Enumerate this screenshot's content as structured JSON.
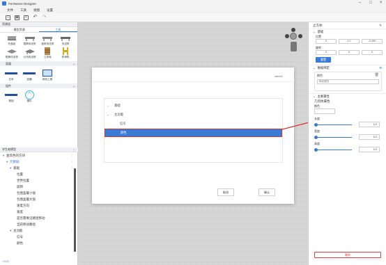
{
  "app": {
    "title": "FenNeese Designer"
  },
  "menu": [
    "文件",
    "工具",
    "视图",
    "设置"
  ],
  "left": {
    "section1_title": "资源组",
    "tabs": [
      "模型资源",
      "工具"
    ],
    "shelves": [
      "托盘组",
      "辊筒传送带",
      "链条传送带",
      "传送带",
      "辊筒传送带",
      "分流传送带",
      "立体库",
      "码垛机"
    ],
    "group_title": "容器",
    "cards": [
      "文本",
      "容器",
      "网页工具"
    ],
    "plugin_title": "组件",
    "plugin_cards": [
      "按钮",
      "指引"
    ],
    "tree_title": "学生老模型",
    "tree": [
      {
        "label": "金资色的方块",
        "indent": 0
      },
      {
        "label": "元数据",
        "indent": 1
      },
      {
        "label": "基础",
        "indent": 2
      },
      {
        "label": "位置",
        "indent": 3
      },
      {
        "label": "世界位置",
        "indent": 3
      },
      {
        "label": "旋转",
        "indent": 3
      },
      {
        "label": "包围盒最小值",
        "indent": 3
      },
      {
        "label": "包围盒最大值",
        "indent": 3
      },
      {
        "label": "速度方向",
        "indent": 3
      },
      {
        "label": "速度",
        "indent": 3
      },
      {
        "label": "是否需要沿路径移动",
        "indent": 3
      },
      {
        "label": "当前移动路径",
        "indent": 3
      },
      {
        "label": "主功能",
        "indent": 2
      },
      {
        "label": "信号",
        "indent": 3
      },
      {
        "label": "颜色",
        "indent": 3
      }
    ],
    "footer": "v0.00"
  },
  "dialog": {
    "title": "cam01",
    "rows": [
      {
        "label": "基础",
        "indent": 0,
        "arrow": "›"
      },
      {
        "label": "主功能",
        "indent": 0,
        "arrow": "⌄"
      },
      {
        "label": "信号",
        "indent": 1,
        "arrow": ""
      },
      {
        "label": "颜色",
        "indent": 1,
        "arrow": ""
      }
    ],
    "cancel": "取消",
    "ok": "确认"
  },
  "right": {
    "title": "立方体",
    "sec_basic": "基础",
    "pos_label": "位置",
    "pos": [
      "0",
      "0.1",
      "-0.059"
    ],
    "rot_label": "旋转",
    "rot": [
      "0",
      "0",
      "0"
    ],
    "reset": "重置",
    "sec_data": "数据绑定",
    "data_item": "颜色",
    "data_hint": "绑定属性",
    "sec_main": "主要属性",
    "geo_title": "几何体属性",
    "color_label": "颜色",
    "len_label": "长度",
    "len": "0.2",
    "wid_label": "宽度",
    "wid": "0.2",
    "hgt_label": "高度",
    "hgt": "0.2",
    "delete": "删除"
  },
  "colors": {
    "accent": "#3a7bd5",
    "selection_border": "#d9342b",
    "delete": "#e03b3b"
  }
}
